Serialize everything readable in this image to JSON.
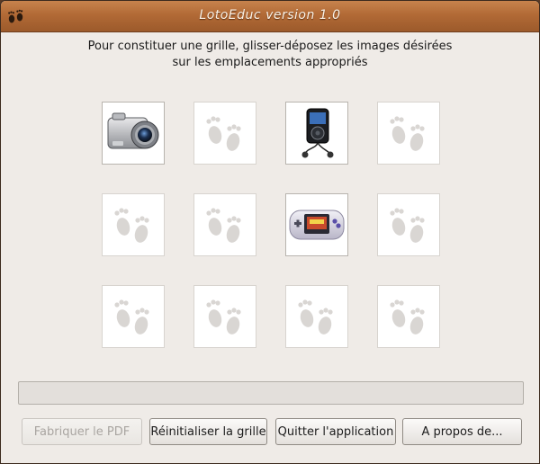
{
  "window": {
    "title": "LotoEduc version 1.0",
    "app_icon": "footprints-icon"
  },
  "instructions": {
    "line1": "Pour constituer une grille, glisser-déposez les images désirées",
    "line2": "sur les emplacements appropriés"
  },
  "grid": {
    "rows": 3,
    "cols": 4,
    "cells": [
      {
        "content": "camera"
      },
      {
        "content": "empty"
      },
      {
        "content": "media-player"
      },
      {
        "content": "empty"
      },
      {
        "content": "empty"
      },
      {
        "content": "empty"
      },
      {
        "content": "game-console"
      },
      {
        "content": "empty"
      },
      {
        "content": "empty"
      },
      {
        "content": "empty"
      },
      {
        "content": "empty"
      },
      {
        "content": "empty"
      }
    ]
  },
  "progress": {
    "value": 0
  },
  "buttons": {
    "pdf": "Fabriquer le PDF",
    "reset": "Réinitialiser la grille",
    "quit": "Quitter l'application",
    "about": "A propos de..."
  },
  "colors": {
    "titlebar": "#b26a36",
    "window_bg": "#efebe7",
    "placeholder_icon": "#d9d6d3"
  }
}
